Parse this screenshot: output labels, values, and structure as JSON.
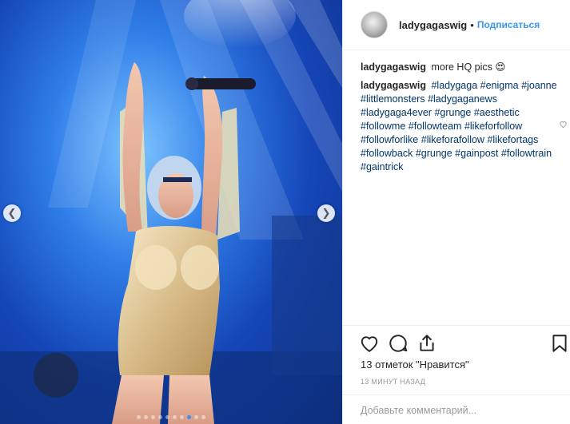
{
  "post": {
    "photo_icon": "concert-performer-photo",
    "carousel": {
      "slides": 10,
      "active": 7
    }
  },
  "header": {
    "username": "ladygagaswig",
    "separator": "•",
    "follow_label": "Подписаться"
  },
  "caption": {
    "username": "ladygagaswig",
    "text": "more HQ pics 😍"
  },
  "comment": {
    "username": "ladygagaswig",
    "tags": [
      "#ladygaga",
      "#enigma",
      "#joanne",
      "#littlemonsters",
      "#ladygaganews",
      "#ladygaga4ever",
      "#grunge",
      "#aesthetic",
      "#followme",
      "#followteam",
      "#likeforfollow",
      "#followforlike",
      "#likeforafollow",
      "#likefortags",
      "#followback",
      "#grunge",
      "#gainpost",
      "#followtrain",
      "#gaintrick"
    ]
  },
  "likes_text": "13 отметок \"Нравится\"",
  "time_ago": "13 МИНУТ НАЗАД",
  "comment_placeholder": "Добавьте комментарий...",
  "colors": {
    "link": "#3897f0",
    "hashtag": "#003569",
    "active_dot": "#3b8ff0"
  }
}
